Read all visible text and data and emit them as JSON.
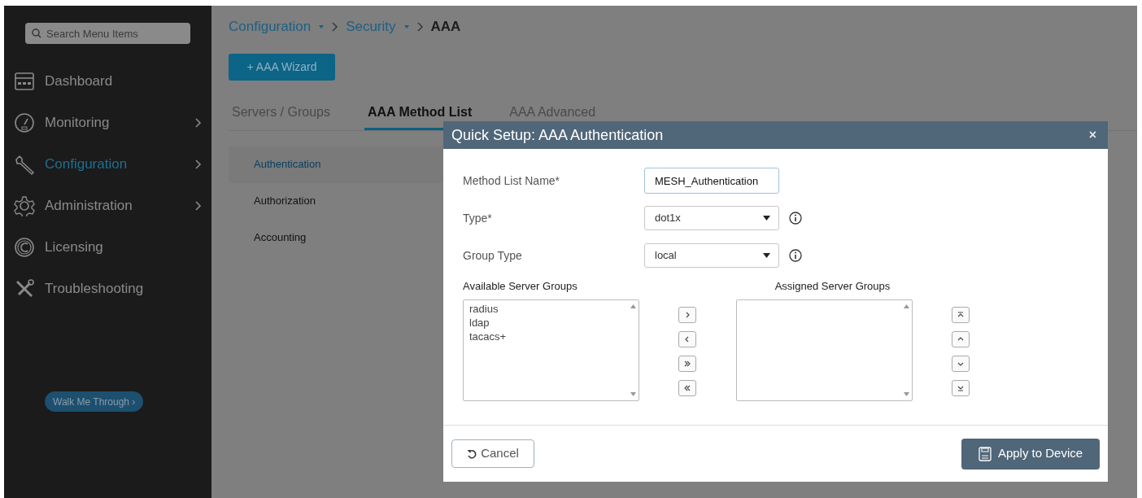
{
  "sidebar": {
    "search": {
      "placeholder": "Search Menu Items"
    },
    "items": [
      {
        "label": "Dashboard",
        "kind": "dashboard",
        "selected": false,
        "submenu": false
      },
      {
        "label": "Monitoring",
        "kind": "gauge",
        "selected": false,
        "submenu": true
      },
      {
        "label": "Configuration",
        "kind": "wrench",
        "selected": true,
        "submenu": true
      },
      {
        "label": "Administration",
        "kind": "gear",
        "selected": false,
        "submenu": true
      },
      {
        "label": "Licensing",
        "kind": "license",
        "selected": false,
        "submenu": false
      },
      {
        "label": "Troubleshooting",
        "kind": "tools",
        "selected": false,
        "submenu": false
      }
    ],
    "walk_button": "Walk Me Through ›"
  },
  "breadcrumb": [
    {
      "label": "Configuration",
      "dropdown": true
    },
    {
      "label": "Security",
      "dropdown": true
    },
    {
      "label": "AAA",
      "dropdown": false
    }
  ],
  "wizard_button": "+ AAA Wizard",
  "tabs": [
    {
      "label": "Servers / Groups",
      "selected": false
    },
    {
      "label": "AAA Method List",
      "selected": true
    },
    {
      "label": "AAA Advanced",
      "selected": false
    }
  ],
  "method_menu": [
    {
      "label": "Authentication",
      "selected": true
    },
    {
      "label": "Authorization",
      "selected": false
    },
    {
      "label": "Accounting",
      "selected": false
    }
  ],
  "modal": {
    "title": "Quick Setup: AAA Authentication",
    "close": "×",
    "fields": [
      {
        "label": "Method List Name*",
        "kind": "text",
        "value": "MESH_Authentication",
        "info": false
      },
      {
        "label": "Type*",
        "kind": "select",
        "value": "dot1x",
        "info": true
      },
      {
        "label": "Group Type",
        "kind": "select",
        "value": "local",
        "info": true
      }
    ],
    "available": {
      "heading": "Available Server Groups",
      "options": [
        "radius",
        "ldap",
        "tacacs+"
      ]
    },
    "assigned": {
      "heading": "Assigned Server Groups"
    },
    "cancel_button": "Cancel",
    "apply_button": "Apply to Device"
  }
}
